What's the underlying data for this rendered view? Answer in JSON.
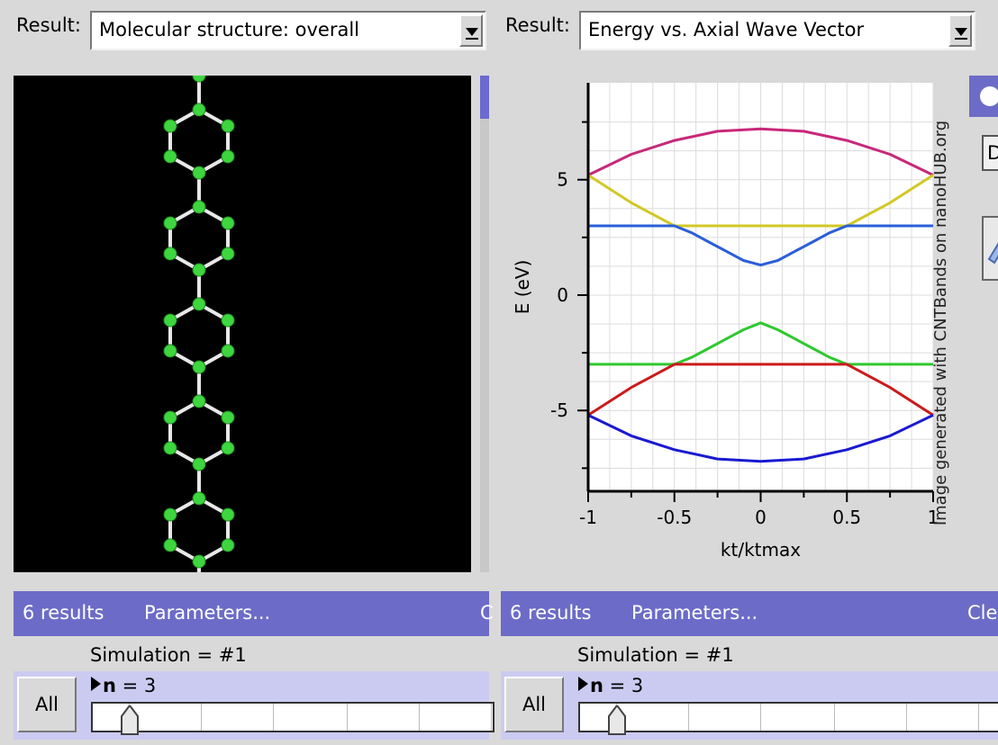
{
  "left": {
    "result_label": "Result:",
    "result_value": "Molecular structure: overall",
    "status": {
      "count": "6 results",
      "params": "Parameters...",
      "extra": "C"
    },
    "simulation": "Simulation = #1",
    "n_name": "n",
    "n_value": "= 3",
    "all_label": "All"
  },
  "right": {
    "result_label": "Result:",
    "result_value": "Energy vs. Axial Wave Vector",
    "status": {
      "count": "6 results",
      "params": "Parameters...",
      "extra": "Cle"
    },
    "simulation": "Simulation = #1",
    "n_name": "n",
    "n_value": "= 3",
    "all_label": "All",
    "side_letter": "D"
  },
  "chart_data": {
    "type": "line",
    "xlabel": "kt/ktmax",
    "ylabel": "E (eV)",
    "xlim": [
      -1,
      1
    ],
    "ylim": [
      -8.5,
      9.2
    ],
    "xticks": [
      "-1",
      "-0.5",
      "0",
      "0.5",
      "1"
    ],
    "yticks": [
      "5",
      "0",
      "-5"
    ],
    "yticks_values": [
      5,
      0,
      -5
    ],
    "watermark": "Image generated with CNTBands on nanoHUB.org",
    "grid": true,
    "series": [
      {
        "color": "#c8287a",
        "x": [
          -1,
          -0.75,
          -0.5,
          -0.25,
          0,
          0.25,
          0.5,
          0.75,
          1
        ],
        "y": [
          5.2,
          6.1,
          6.7,
          7.1,
          7.2,
          7.1,
          6.7,
          6.1,
          5.2
        ]
      },
      {
        "color": "#d2c825",
        "x": [
          -1,
          -0.75,
          -0.5,
          -0.25,
          0,
          0.25,
          0.5,
          0.75,
          1
        ],
        "y": [
          5.2,
          4.0,
          3.0,
          3.0,
          3.0,
          3.0,
          3.0,
          4.0,
          5.2
        ]
      },
      {
        "color": "#2a5fd8",
        "x": [
          -1,
          -0.5,
          -0.4,
          -0.3,
          -0.2,
          -0.1,
          0,
          0.1,
          0.2,
          0.3,
          0.4,
          0.5,
          1
        ],
        "y": [
          3.0,
          3.0,
          2.7,
          2.3,
          1.9,
          1.5,
          1.3,
          1.5,
          1.9,
          2.3,
          2.7,
          3.0,
          3.0
        ]
      },
      {
        "color": "#2fc82f",
        "x": [
          -1,
          -0.5,
          -0.4,
          -0.3,
          -0.2,
          -0.1,
          0,
          0.1,
          0.2,
          0.3,
          0.4,
          0.5,
          1
        ],
        "y": [
          -3.0,
          -3.0,
          -2.7,
          -2.3,
          -1.9,
          -1.5,
          -1.2,
          -1.5,
          -1.9,
          -2.3,
          -2.7,
          -3.0,
          -3.0
        ]
      },
      {
        "color": "#cc1a1a",
        "x": [
          -1,
          -0.75,
          -0.5,
          -0.25,
          0,
          0.25,
          0.5,
          0.75,
          1
        ],
        "y": [
          -5.2,
          -4.0,
          -3.0,
          -3.0,
          -3.0,
          -3.0,
          -3.0,
          -4.0,
          -5.2
        ]
      },
      {
        "color": "#1a1ad0",
        "x": [
          -1,
          -0.75,
          -0.5,
          -0.25,
          0,
          0.25,
          0.5,
          0.75,
          1
        ],
        "y": [
          -5.2,
          -6.1,
          -6.7,
          -7.1,
          -7.2,
          -7.1,
          -6.7,
          -6.1,
          -5.2
        ]
      }
    ]
  }
}
